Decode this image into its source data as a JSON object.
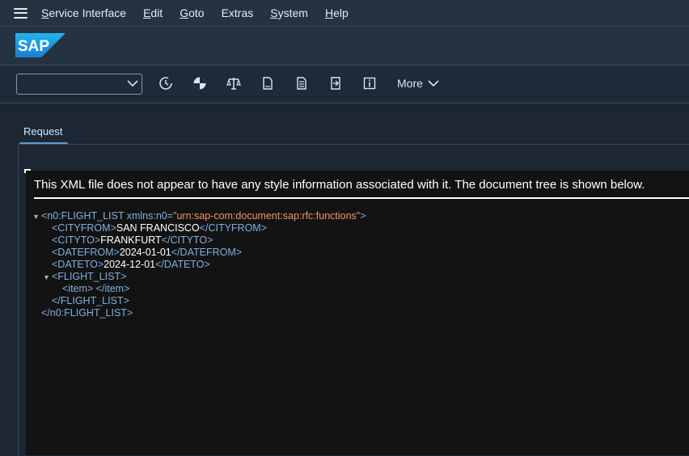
{
  "menubar": {
    "items": [
      {
        "label": "Service Interface",
        "underline": "S",
        "rest": "ervice Interface"
      },
      {
        "label": "Edit",
        "underline": "E",
        "rest": "dit"
      },
      {
        "label": "Goto",
        "underline": "G",
        "rest": "oto"
      },
      {
        "label": "Extras",
        "underline": "",
        "rest": "Extras"
      },
      {
        "label": "System",
        "underline": "S",
        "rest": "ystem"
      },
      {
        "label": "Help",
        "underline": "H",
        "rest": "elp"
      }
    ]
  },
  "shell": {
    "logo_text": "SAP",
    "brand_color": "#1a9fd8"
  },
  "toolbar": {
    "command_field": {
      "value": "",
      "placeholder": ""
    },
    "icons": [
      "history-icon",
      "test-icon",
      "compare-icon",
      "document-icon",
      "document-list-icon",
      "export-icon",
      "info-icon"
    ],
    "more_label": "More"
  },
  "tabs": [
    {
      "label": "Request",
      "active": true
    }
  ],
  "xml": {
    "header": "This XML file does not appear to have any style information associated with it. The document tree is shown below.",
    "root_open": "<n0:FLIGHT_LIST",
    "root_attr_name": " xmlns:n0=",
    "root_attr_value": "\"urn:sap-com:document:sap:rfc:functions\"",
    "root_open_end": ">",
    "fields": [
      {
        "open": "<CITYFROM>",
        "value": "SAN FRANCISCO",
        "close": "</CITYFROM>"
      },
      {
        "open": "<CITYTO>",
        "value": "FRANKFURT",
        "close": "</CITYTO>"
      },
      {
        "open": "<DATEFROM>",
        "value": "2024-01-01",
        "close": "</DATEFROM>"
      },
      {
        "open": "<DATETO>",
        "value": "2024-12-01",
        "close": "</DATETO>"
      }
    ],
    "list_open": "<FLIGHT_LIST>",
    "item_line": "<item> </item>",
    "list_close": "</FLIGHT_LIST>",
    "root_close": "</n0:FLIGHT_LIST>",
    "toggle_glyph": "▼"
  }
}
